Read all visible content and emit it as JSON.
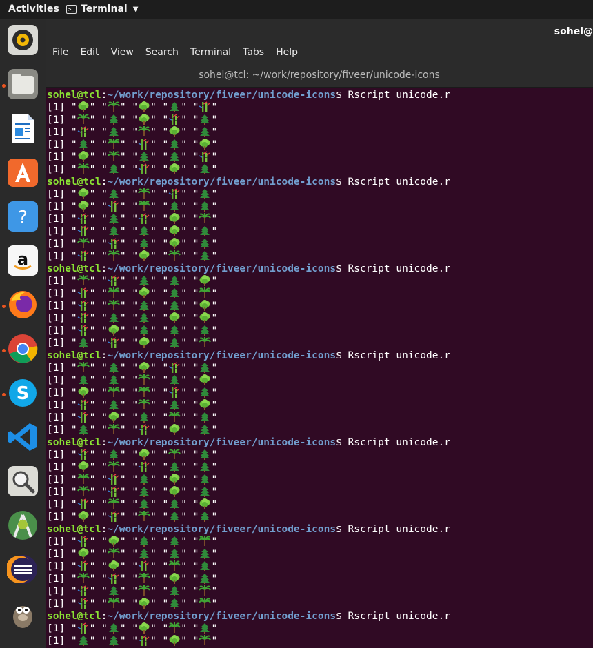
{
  "topbar": {
    "activities": "Activities",
    "app_name": "Terminal",
    "app_icon_glyph": ">_"
  },
  "dock": {
    "items": [
      {
        "icon": "rhythmbox-icon",
        "running": false
      },
      {
        "icon": "files-icon",
        "running": true
      },
      {
        "icon": "writer-icon",
        "running": false
      },
      {
        "icon": "software-icon",
        "running": false
      },
      {
        "icon": "help-icon",
        "running": false
      },
      {
        "icon": "amazon-icon",
        "running": false
      },
      {
        "icon": "firefox-icon",
        "running": true
      },
      {
        "icon": "chrome-icon",
        "running": true
      },
      {
        "icon": "skype-icon",
        "running": true
      },
      {
        "icon": "vscode-icon",
        "running": false
      },
      {
        "icon": "image-viewer-icon",
        "running": false
      },
      {
        "icon": "android-studio-icon",
        "running": false
      },
      {
        "icon": "eclipse-icon",
        "running": false
      },
      {
        "icon": "gimp-icon",
        "running": false
      }
    ]
  },
  "window": {
    "user_corner": "sohel@",
    "menu": [
      "File",
      "Edit",
      "View",
      "Search",
      "Terminal",
      "Tabs",
      "Help"
    ],
    "title": "sohel@tcl: ~/work/repository/fiveer/unicode-icons"
  },
  "terminal": {
    "prompt_user": "sohel@tcl",
    "prompt_sep": ":",
    "prompt_path": "~/work/repository/fiveer/unicode-icons",
    "prompt_end": "$ ",
    "command": "Rscript unicode.r",
    "row_prefix": "[1]",
    "blocks": [
      [
        [
          "deciduous",
          "palm",
          "deciduous",
          "evergreen",
          "bamboo"
        ],
        [
          "palm",
          "evergreen",
          "deciduous",
          "bamboo",
          "evergreen"
        ],
        [
          "bamboo",
          "evergreen",
          "palm",
          "deciduous",
          "evergreen"
        ],
        [
          "evergreen",
          "palm",
          "bamboo",
          "evergreen",
          "deciduous"
        ],
        [
          "deciduous",
          "palm",
          "evergreen",
          "evergreen",
          "bamboo"
        ],
        [
          "palm",
          "evergreen",
          "bamboo",
          "deciduous",
          "evergreen"
        ]
      ],
      [
        [
          "deciduous",
          "evergreen",
          "palm",
          "bamboo",
          "evergreen"
        ],
        [
          "deciduous",
          "bamboo",
          "palm",
          "evergreen",
          "evergreen"
        ],
        [
          "bamboo",
          "evergreen",
          "bamboo",
          "deciduous",
          "palm"
        ],
        [
          "bamboo",
          "evergreen",
          "evergreen",
          "deciduous",
          "evergreen"
        ],
        [
          "palm",
          "bamboo",
          "evergreen",
          "deciduous",
          "evergreen"
        ],
        [
          "bamboo",
          "palm",
          "deciduous",
          "palm",
          "evergreen"
        ]
      ],
      [
        [
          "palm",
          "bamboo",
          "evergreen",
          "evergreen",
          "deciduous"
        ],
        [
          "bamboo",
          "palm",
          "deciduous",
          "evergreen",
          "palm"
        ],
        [
          "bamboo",
          "palm",
          "evergreen",
          "evergreen",
          "deciduous"
        ],
        [
          "bamboo",
          "evergreen",
          "evergreen",
          "deciduous",
          "deciduous"
        ],
        [
          "bamboo",
          "deciduous",
          "evergreen",
          "evergreen",
          "evergreen"
        ],
        [
          "evergreen",
          "bamboo",
          "deciduous",
          "evergreen",
          "palm"
        ]
      ],
      [
        [
          "palm",
          "evergreen",
          "deciduous",
          "bamboo",
          "evergreen"
        ],
        [
          "evergreen",
          "evergreen",
          "palm",
          "evergreen",
          "deciduous"
        ],
        [
          "deciduous",
          "palm",
          "palm",
          "bamboo",
          "evergreen"
        ],
        [
          "bamboo",
          "evergreen",
          "palm",
          "evergreen",
          "deciduous"
        ],
        [
          "bamboo",
          "deciduous",
          "evergreen",
          "palm",
          "evergreen"
        ],
        [
          "evergreen",
          "palm",
          "bamboo",
          "deciduous",
          "evergreen"
        ]
      ],
      [
        [
          "bamboo",
          "evergreen",
          "deciduous",
          "palm",
          "evergreen"
        ],
        [
          "deciduous",
          "palm",
          "bamboo",
          "evergreen",
          "evergreen"
        ],
        [
          "palm",
          "bamboo",
          "evergreen",
          "deciduous",
          "evergreen"
        ],
        [
          "palm",
          "bamboo",
          "evergreen",
          "deciduous",
          "evergreen"
        ],
        [
          "bamboo",
          "palm",
          "evergreen",
          "evergreen",
          "deciduous"
        ],
        [
          "deciduous",
          "bamboo",
          "palm",
          "evergreen",
          "evergreen"
        ]
      ],
      [
        [
          "bamboo",
          "deciduous",
          "evergreen",
          "evergreen",
          "palm"
        ],
        [
          "deciduous",
          "palm",
          "evergreen",
          "evergreen",
          "evergreen"
        ],
        [
          "bamboo",
          "deciduous",
          "bamboo",
          "palm",
          "evergreen"
        ],
        [
          "palm",
          "bamboo",
          "palm",
          "deciduous",
          "evergreen"
        ],
        [
          "bamboo",
          "evergreen",
          "palm",
          "evergreen",
          "palm"
        ],
        [
          "bamboo",
          "palm",
          "deciduous",
          "evergreen",
          "palm"
        ]
      ],
      [
        [
          "bamboo",
          "evergreen",
          "deciduous",
          "palm",
          "evergreen"
        ],
        [
          "evergreen",
          "evergreen",
          "bamboo",
          "deciduous",
          "palm"
        ]
      ]
    ]
  },
  "colors": {
    "terminal_bg": "#300a24",
    "prompt_user": "#8ae234",
    "prompt_path": "#729fcf",
    "accent_dot": "#e95420"
  }
}
